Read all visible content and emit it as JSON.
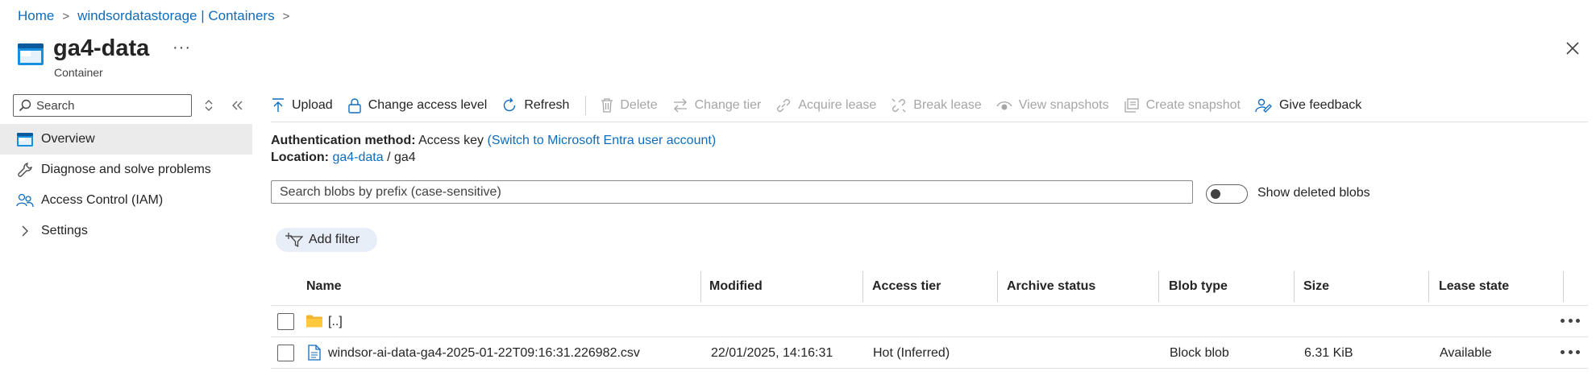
{
  "breadcrumb": {
    "items": [
      "Home",
      "windsordatastorage | Containers"
    ],
    "separator": ">"
  },
  "header": {
    "title": "ga4-data",
    "subtitle": "Container",
    "more": "···"
  },
  "sidebar": {
    "search_placeholder": "Search",
    "items": [
      {
        "label": "Overview",
        "icon": "container-icon",
        "active": true
      },
      {
        "label": "Diagnose and solve problems",
        "icon": "wrench-icon"
      },
      {
        "label": "Access Control (IAM)",
        "icon": "people-icon"
      },
      {
        "label": "Settings",
        "icon": "chevron-right-icon"
      }
    ]
  },
  "toolbar": {
    "upload": "Upload",
    "change_access": "Change access level",
    "refresh": "Refresh",
    "delete": "Delete",
    "change_tier": "Change tier",
    "acquire_lease": "Acquire lease",
    "break_lease": "Break lease",
    "view_snapshots": "View snapshots",
    "create_snapshot": "Create snapshot",
    "give_feedback": "Give feedback"
  },
  "info": {
    "auth_label": "Authentication method:",
    "auth_value": "Access key",
    "auth_link": "(Switch to Microsoft Entra user account)",
    "location_label": "Location:",
    "location_link": "ga4-data",
    "location_sep": "/",
    "location_path": "ga4"
  },
  "blob_search": {
    "placeholder": "Search blobs by prefix (case-sensitive)"
  },
  "show_deleted": {
    "label": "Show deleted blobs",
    "on": false
  },
  "add_filter": "Add filter",
  "table": {
    "columns": [
      "Name",
      "Modified",
      "Access tier",
      "Archive status",
      "Blob type",
      "Size",
      "Lease state"
    ],
    "rows": [
      {
        "name": "[..]",
        "type": "folder",
        "modified": "",
        "access_tier": "",
        "archive_status": "",
        "blob_type": "",
        "size": "",
        "lease_state": ""
      },
      {
        "name": "windsor-ai-data-ga4-2025-01-22T09:16:31.226982.csv",
        "type": "file",
        "modified": "22/01/2025, 14:16:31",
        "access_tier": "Hot (Inferred)",
        "archive_status": "",
        "blob_type": "Block blob",
        "size": "6.31 KiB",
        "lease_state": "Available"
      }
    ]
  },
  "colors": {
    "link": "#0f6cbd",
    "disabled": "#a6a6a6",
    "folder": "#f2b531",
    "active_bg": "#ebebeb"
  }
}
